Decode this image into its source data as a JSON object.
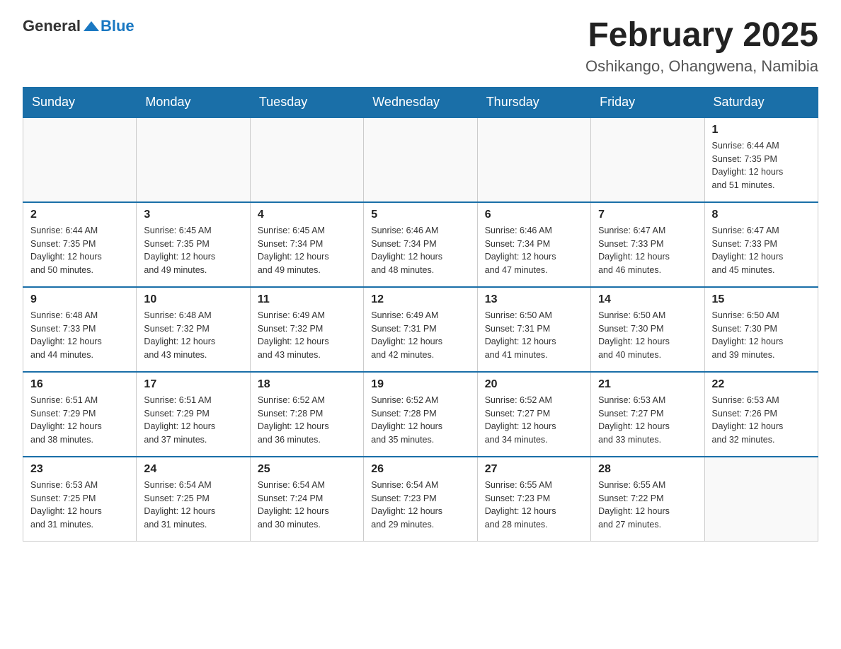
{
  "logo": {
    "text_general": "General",
    "text_blue": "Blue"
  },
  "header": {
    "month_title": "February 2025",
    "location": "Oshikango, Ohangwena, Namibia"
  },
  "days_of_week": [
    "Sunday",
    "Monday",
    "Tuesday",
    "Wednesday",
    "Thursday",
    "Friday",
    "Saturday"
  ],
  "weeks": [
    [
      {
        "day": "",
        "info": ""
      },
      {
        "day": "",
        "info": ""
      },
      {
        "day": "",
        "info": ""
      },
      {
        "day": "",
        "info": ""
      },
      {
        "day": "",
        "info": ""
      },
      {
        "day": "",
        "info": ""
      },
      {
        "day": "1",
        "info": "Sunrise: 6:44 AM\nSunset: 7:35 PM\nDaylight: 12 hours\nand 51 minutes."
      }
    ],
    [
      {
        "day": "2",
        "info": "Sunrise: 6:44 AM\nSunset: 7:35 PM\nDaylight: 12 hours\nand 50 minutes."
      },
      {
        "day": "3",
        "info": "Sunrise: 6:45 AM\nSunset: 7:35 PM\nDaylight: 12 hours\nand 49 minutes."
      },
      {
        "day": "4",
        "info": "Sunrise: 6:45 AM\nSunset: 7:34 PM\nDaylight: 12 hours\nand 49 minutes."
      },
      {
        "day": "5",
        "info": "Sunrise: 6:46 AM\nSunset: 7:34 PM\nDaylight: 12 hours\nand 48 minutes."
      },
      {
        "day": "6",
        "info": "Sunrise: 6:46 AM\nSunset: 7:34 PM\nDaylight: 12 hours\nand 47 minutes."
      },
      {
        "day": "7",
        "info": "Sunrise: 6:47 AM\nSunset: 7:33 PM\nDaylight: 12 hours\nand 46 minutes."
      },
      {
        "day": "8",
        "info": "Sunrise: 6:47 AM\nSunset: 7:33 PM\nDaylight: 12 hours\nand 45 minutes."
      }
    ],
    [
      {
        "day": "9",
        "info": "Sunrise: 6:48 AM\nSunset: 7:33 PM\nDaylight: 12 hours\nand 44 minutes."
      },
      {
        "day": "10",
        "info": "Sunrise: 6:48 AM\nSunset: 7:32 PM\nDaylight: 12 hours\nand 43 minutes."
      },
      {
        "day": "11",
        "info": "Sunrise: 6:49 AM\nSunset: 7:32 PM\nDaylight: 12 hours\nand 43 minutes."
      },
      {
        "day": "12",
        "info": "Sunrise: 6:49 AM\nSunset: 7:31 PM\nDaylight: 12 hours\nand 42 minutes."
      },
      {
        "day": "13",
        "info": "Sunrise: 6:50 AM\nSunset: 7:31 PM\nDaylight: 12 hours\nand 41 minutes."
      },
      {
        "day": "14",
        "info": "Sunrise: 6:50 AM\nSunset: 7:30 PM\nDaylight: 12 hours\nand 40 minutes."
      },
      {
        "day": "15",
        "info": "Sunrise: 6:50 AM\nSunset: 7:30 PM\nDaylight: 12 hours\nand 39 minutes."
      }
    ],
    [
      {
        "day": "16",
        "info": "Sunrise: 6:51 AM\nSunset: 7:29 PM\nDaylight: 12 hours\nand 38 minutes."
      },
      {
        "day": "17",
        "info": "Sunrise: 6:51 AM\nSunset: 7:29 PM\nDaylight: 12 hours\nand 37 minutes."
      },
      {
        "day": "18",
        "info": "Sunrise: 6:52 AM\nSunset: 7:28 PM\nDaylight: 12 hours\nand 36 minutes."
      },
      {
        "day": "19",
        "info": "Sunrise: 6:52 AM\nSunset: 7:28 PM\nDaylight: 12 hours\nand 35 minutes."
      },
      {
        "day": "20",
        "info": "Sunrise: 6:52 AM\nSunset: 7:27 PM\nDaylight: 12 hours\nand 34 minutes."
      },
      {
        "day": "21",
        "info": "Sunrise: 6:53 AM\nSunset: 7:27 PM\nDaylight: 12 hours\nand 33 minutes."
      },
      {
        "day": "22",
        "info": "Sunrise: 6:53 AM\nSunset: 7:26 PM\nDaylight: 12 hours\nand 32 minutes."
      }
    ],
    [
      {
        "day": "23",
        "info": "Sunrise: 6:53 AM\nSunset: 7:25 PM\nDaylight: 12 hours\nand 31 minutes."
      },
      {
        "day": "24",
        "info": "Sunrise: 6:54 AM\nSunset: 7:25 PM\nDaylight: 12 hours\nand 31 minutes."
      },
      {
        "day": "25",
        "info": "Sunrise: 6:54 AM\nSunset: 7:24 PM\nDaylight: 12 hours\nand 30 minutes."
      },
      {
        "day": "26",
        "info": "Sunrise: 6:54 AM\nSunset: 7:23 PM\nDaylight: 12 hours\nand 29 minutes."
      },
      {
        "day": "27",
        "info": "Sunrise: 6:55 AM\nSunset: 7:23 PM\nDaylight: 12 hours\nand 28 minutes."
      },
      {
        "day": "28",
        "info": "Sunrise: 6:55 AM\nSunset: 7:22 PM\nDaylight: 12 hours\nand 27 minutes."
      },
      {
        "day": "",
        "info": ""
      }
    ]
  ]
}
